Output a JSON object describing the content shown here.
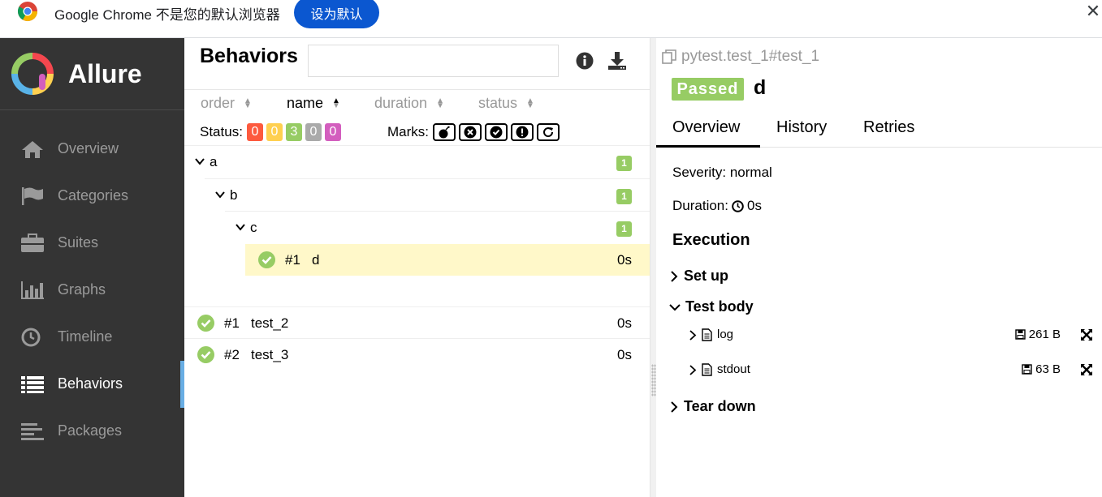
{
  "infobar": {
    "message": "Google Chrome 不是您的默认浏览器",
    "set_default": "设为默认"
  },
  "sidebar": {
    "brand": "Allure",
    "items": [
      {
        "label": "Overview",
        "icon": "home-icon"
      },
      {
        "label": "Categories",
        "icon": "flag-icon"
      },
      {
        "label": "Suites",
        "icon": "briefcase-icon"
      },
      {
        "label": "Graphs",
        "icon": "bar-chart-icon"
      },
      {
        "label": "Timeline",
        "icon": "clock-icon"
      },
      {
        "label": "Behaviors",
        "icon": "list-icon",
        "active": true
      },
      {
        "label": "Packages",
        "icon": "align-left-icon"
      }
    ]
  },
  "behaviors": {
    "title": "Behaviors",
    "search_placeholder": "",
    "sorters": [
      "order",
      "name",
      "duration",
      "status"
    ],
    "status_label": "Status:",
    "status_counts": [
      {
        "value": "0",
        "color": "#fd5a3e"
      },
      {
        "value": "0",
        "color": "#ffd050"
      },
      {
        "value": "3",
        "color": "#97cc64"
      },
      {
        "value": "0",
        "color": "#aaaaaa"
      },
      {
        "value": "0",
        "color": "#d35ebe"
      }
    ],
    "marks_label": "Marks:",
    "marks": [
      "bomb-icon",
      "x-circle-icon",
      "check-circle-icon",
      "exclamation-icon",
      "refresh-icon"
    ],
    "tree": [
      {
        "label": "a",
        "count": "1"
      },
      {
        "label": "b",
        "count": "1"
      },
      {
        "label": "c",
        "count": "1"
      }
    ],
    "selected_leaf": {
      "num": "#1",
      "name": "d",
      "duration": "0s"
    },
    "leaves": [
      {
        "num": "#1",
        "name": "test_2",
        "duration": "0s"
      },
      {
        "num": "#2",
        "name": "test_3",
        "duration": "0s"
      }
    ]
  },
  "detail": {
    "path": "pytest.test_1#test_1",
    "status": "Passed",
    "name": "d",
    "tabs": [
      "Overview",
      "History",
      "Retries"
    ],
    "severity": "Severity: normal",
    "duration_label": "Duration:",
    "duration_value": "0s",
    "execution": "Execution",
    "setup": "Set up",
    "test_body": "Test body",
    "attachments": [
      {
        "name": "log",
        "size": "261 B"
      },
      {
        "name": "stdout",
        "size": "63 B"
      }
    ],
    "teardown": "Tear down"
  }
}
